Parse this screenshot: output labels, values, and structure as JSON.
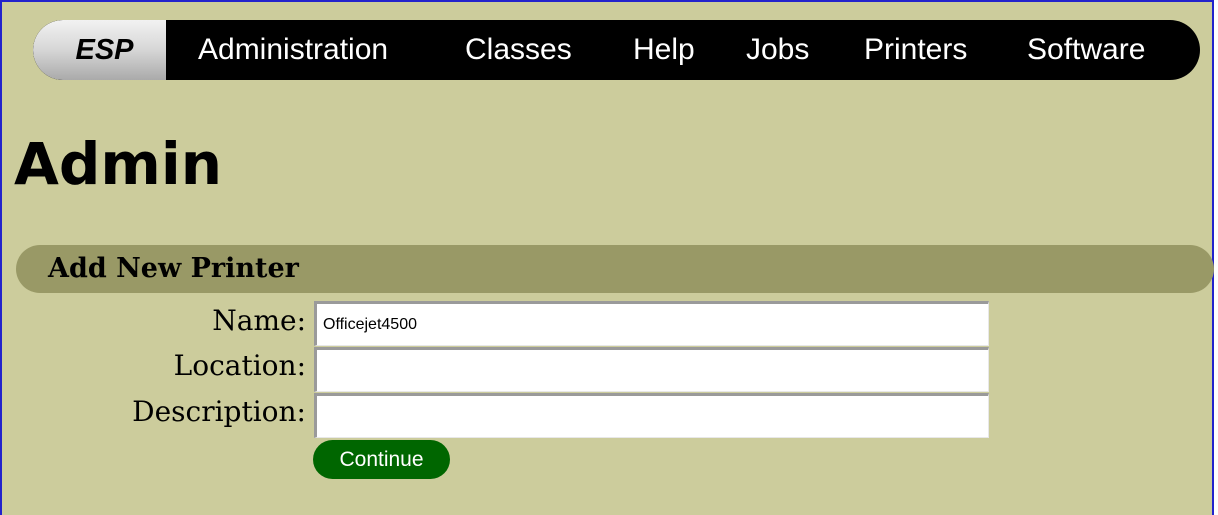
{
  "navbar": {
    "brand": "ESP",
    "items": [
      {
        "label": "Administration"
      },
      {
        "label": "Classes"
      },
      {
        "label": "Help"
      },
      {
        "label": "Jobs"
      },
      {
        "label": "Printers"
      },
      {
        "label": "Software"
      }
    ]
  },
  "page": {
    "title": "Admin"
  },
  "section": {
    "title": "Add New Printer"
  },
  "form": {
    "name_label": "Name:",
    "name_value": "Officejet4500",
    "location_label": "Location:",
    "location_value": "",
    "description_label": "Description:",
    "description_value": "",
    "continue_label": "Continue"
  },
  "colors": {
    "page_background": "#cccc9c",
    "navbar_background": "#000000",
    "section_bar": "#999966",
    "button_green": "#006600",
    "frame_border": "#2222cc"
  }
}
